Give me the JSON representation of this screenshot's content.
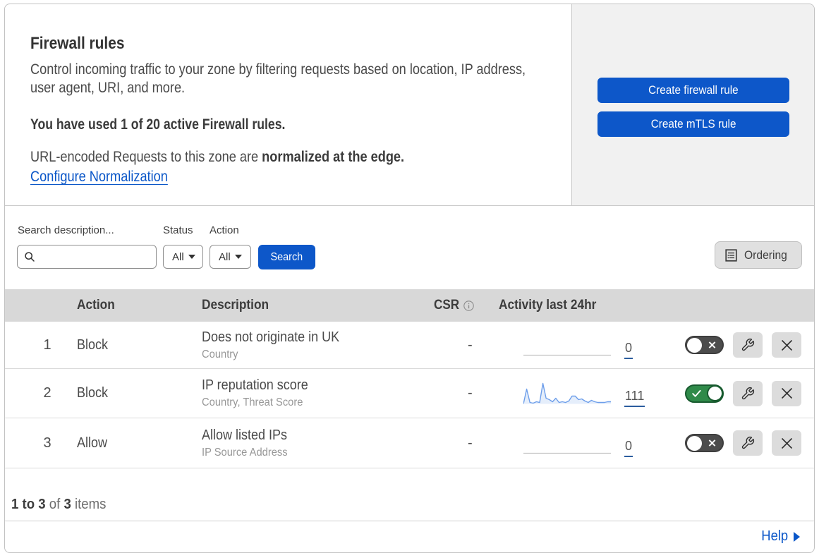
{
  "header": {
    "title": "Firewall rules",
    "description_line1": "Control incoming traffic to your zone by filtering requests based on location, IP address,",
    "description_line2": "user agent, URI, and more.",
    "usage": "You have used 1 of 20 active Firewall rules.",
    "normalization_text": "URL-encoded Requests to this zone are",
    "normalization_bold": "normalized at the edge.",
    "configure_link": "Configure Normalization"
  },
  "actions": {
    "create_firewall_rule": "Create firewall rule",
    "create_mtls_rule": "Create mTLS rule"
  },
  "filters": {
    "search_label": "Search description...",
    "search_value": "",
    "status_label": "Status",
    "status_value": "All",
    "action_label": "Action",
    "action_value": "All",
    "search_button": "Search",
    "ordering_button": "Ordering"
  },
  "table": {
    "headers": {
      "action": "Action",
      "description": "Description",
      "csr": "CSR",
      "activity": "Activity last 24hr"
    },
    "rows": [
      {
        "index": "1",
        "action": "Block",
        "description": "Does not originate in UK",
        "criteria": "Country",
        "csr": "-",
        "activity_count": "0",
        "activity_values": [],
        "enabled": false
      },
      {
        "index": "2",
        "action": "Block",
        "description": "IP reputation score",
        "criteria": "Country, Threat Score",
        "csr": "-",
        "activity_count": "111",
        "activity_values": [
          0,
          21,
          2,
          1,
          3,
          2,
          29,
          8,
          6,
          3,
          8,
          2,
          3,
          2,
          4,
          11,
          11,
          6,
          7,
          4,
          2,
          5,
          3,
          2,
          2,
          2,
          3,
          3
        ],
        "enabled": true
      },
      {
        "index": "3",
        "action": "Allow",
        "description": "Allow listed IPs",
        "criteria": "IP Source Address",
        "csr": "-",
        "activity_count": "0",
        "activity_values": [],
        "enabled": false
      }
    ]
  },
  "footer": {
    "range": "1 to 3",
    "of": "of",
    "total": "3",
    "items": "items",
    "help": "Help"
  },
  "colors": {
    "primary_blue": "#0d57c9",
    "link_blue": "#0a56c8",
    "toggle_on_green": "#2f8a49",
    "toggle_off_grey": "#4c4c4c",
    "header_band_grey": "#d8d8d8",
    "panel_grey": "#f1f1f1",
    "sparkline_blue": "#6d9eea",
    "count_underline_blue": "#2b5d9e"
  }
}
